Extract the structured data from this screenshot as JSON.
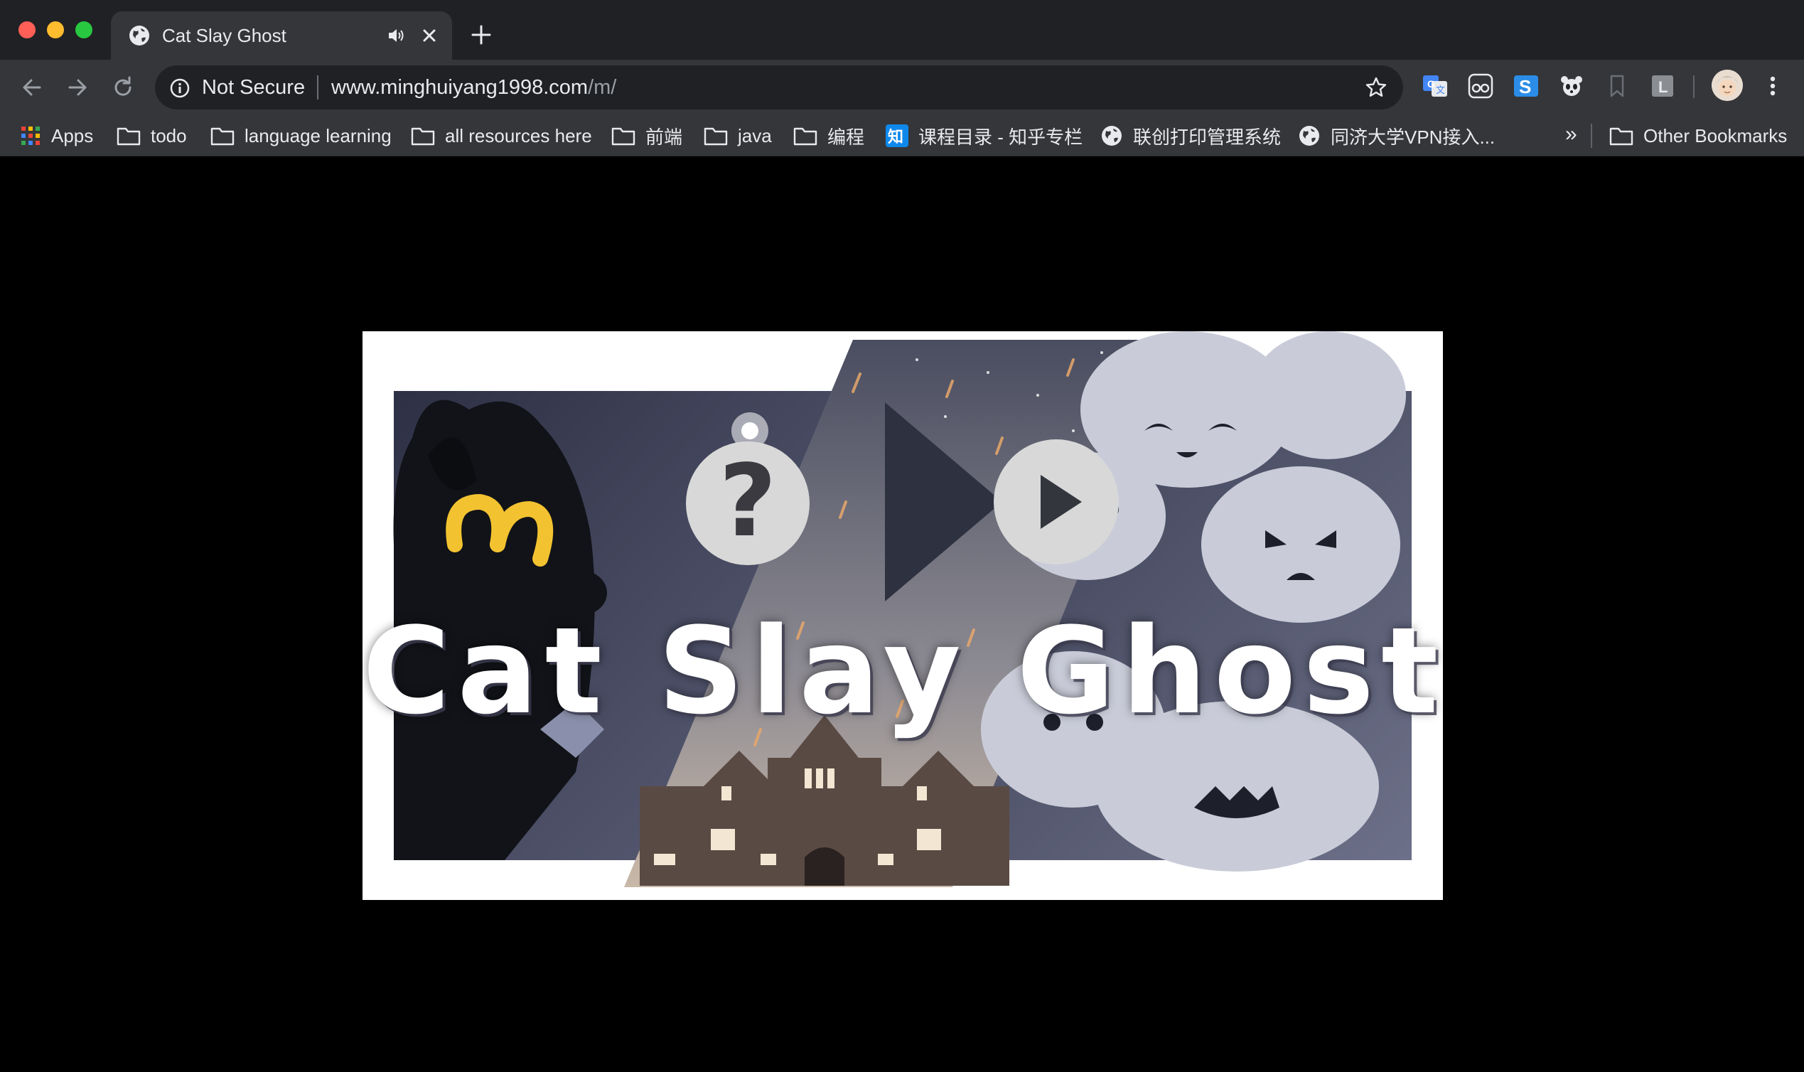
{
  "window": {
    "tab": {
      "title": "Cat Slay Ghost",
      "favicon": "globe-icon",
      "audio": "speaker-icon"
    }
  },
  "toolbar": {
    "security_label": "Not Secure",
    "url_host": "www.minghuiyang1998.com",
    "url_path": "/m/",
    "extensions": [
      "google-translate-icon",
      "glasses-extension-icon",
      "s-extension-icon",
      "panda-extension-icon",
      "bookmark-extension-icon",
      "l-extension-icon"
    ]
  },
  "bookmarks": {
    "items": [
      {
        "label": "Apps",
        "icon": "apps-grid-icon"
      },
      {
        "label": "todo",
        "icon": "folder-icon"
      },
      {
        "label": "language learning",
        "icon": "folder-icon"
      },
      {
        "label": "all resources here",
        "icon": "folder-icon"
      },
      {
        "label": "前端",
        "icon": "folder-icon"
      },
      {
        "label": "java",
        "icon": "folder-icon"
      },
      {
        "label": "编程",
        "icon": "folder-icon"
      },
      {
        "label": "课程目录 - 知乎专栏",
        "icon": "zhihu-icon"
      },
      {
        "label": "联创打印管理系统",
        "icon": "globe-icon"
      },
      {
        "label": "同济大学VPN接入...",
        "icon": "globe-icon"
      }
    ],
    "overflow": "»",
    "other_label": "Other Bookmarks"
  },
  "game": {
    "title": "Cat Slay Ghosts",
    "help_glyph": "?",
    "colors": {
      "cat_eye": "#f2c230",
      "ghost": "#c9ccd8",
      "sky": "#5b5f73",
      "buttons": "#d8d8d8"
    }
  }
}
